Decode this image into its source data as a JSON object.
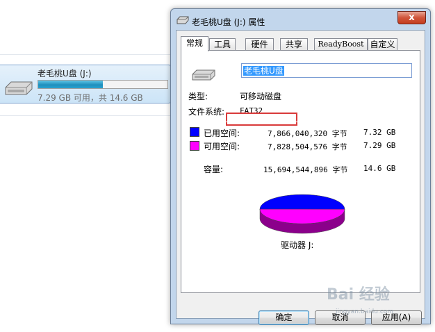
{
  "explorer": {
    "drive": {
      "name": "老毛桃U盘 (J:)",
      "usage_text": "7.29 GB 可用，共 14.6 GB",
      "used_fraction": 0.5,
      "bar_color": "#1f8fbd"
    }
  },
  "dialog": {
    "title": "老毛桃U盘 (J:) 属性",
    "close_label": "x",
    "tabs": [
      {
        "label": "常规"
      },
      {
        "label": "工具"
      },
      {
        "label": "硬件"
      },
      {
        "label": "共享"
      },
      {
        "label": "ReadyBoost"
      },
      {
        "label": "自定义"
      }
    ],
    "general": {
      "volume_label": "老毛桃U盘",
      "type_label": "类型:",
      "type_value": "可移动磁盘",
      "fs_label": "文件系统:",
      "fs_value": "FAT32",
      "used": {
        "label": "已用空间:",
        "bytes": "7,866,040,320 字节",
        "size": "7.32 GB",
        "color": "#0000ff"
      },
      "free": {
        "label": "可用空间:",
        "bytes": "7,828,504,576 字节",
        "size": "7.29 GB",
        "color": "#ff00ff"
      },
      "capacity": {
        "label": "容量:",
        "bytes": "15,694,544,896 字节",
        "size": "14.6 GB"
      },
      "drive_caption": "驱动器 J:"
    },
    "chart_data": {
      "type": "pie",
      "categories": [
        "已用空间",
        "可用空间"
      ],
      "values": [
        7866040320,
        7828504576
      ],
      "colors": [
        "#0000ff",
        "#ff00ff"
      ]
    },
    "buttons": {
      "ok": "确定",
      "cancel": "取消",
      "apply": "应用(A)"
    }
  },
  "watermark": {
    "text": "Bai 经验",
    "sub": "jingyan.baidu.com"
  }
}
